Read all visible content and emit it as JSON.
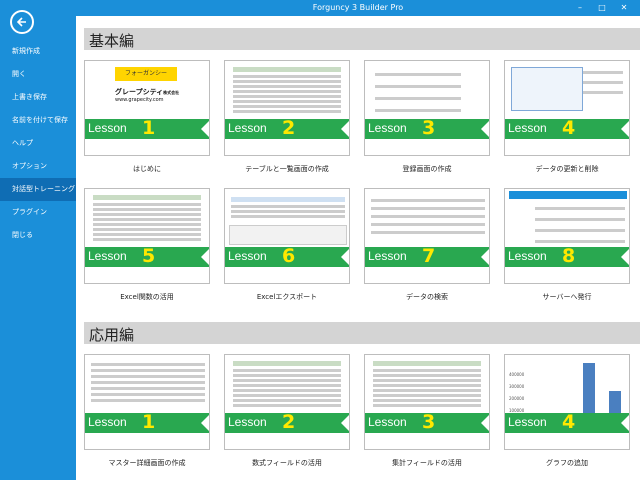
{
  "window": {
    "title": "Forguncy 3 Builder Pro",
    "min": "–",
    "max": "□",
    "close": "✕"
  },
  "sidebar": {
    "items": [
      {
        "label": "新規作成"
      },
      {
        "label": "開く"
      },
      {
        "label": "上書き保存"
      },
      {
        "label": "名前を付けて保存"
      },
      {
        "label": "ヘルプ"
      },
      {
        "label": "オプション"
      },
      {
        "label": "対話型トレーニング",
        "active": true
      },
      {
        "label": "プラグイン"
      },
      {
        "label": "閉じる"
      }
    ]
  },
  "sections": [
    {
      "title": "基本編",
      "cards": [
        {
          "lesson": "Lesson",
          "num": "1",
          "caption": "はじめに",
          "thumb": "logo"
        },
        {
          "lesson": "Lesson",
          "num": "2",
          "caption": "テーブルと一覧画面の作成",
          "thumb": "table"
        },
        {
          "lesson": "Lesson",
          "num": "3",
          "caption": "登録画面の作成",
          "thumb": "form"
        },
        {
          "lesson": "Lesson",
          "num": "4",
          "caption": "データの更新と削除",
          "thumb": "dialog"
        },
        {
          "lesson": "Lesson",
          "num": "5",
          "caption": "Excel関数の活用",
          "thumb": "table"
        },
        {
          "lesson": "Lesson",
          "num": "6",
          "caption": "Excelエクスポート",
          "thumb": "excel"
        },
        {
          "lesson": "Lesson",
          "num": "7",
          "caption": "データの検索",
          "thumb": "search"
        },
        {
          "lesson": "Lesson",
          "num": "8",
          "caption": "サーバーへ発行",
          "thumb": "publish"
        }
      ]
    },
    {
      "title": "応用編",
      "cards": [
        {
          "lesson": "Lesson",
          "num": "1",
          "caption": "マスター詳細画面の作成",
          "thumb": "master"
        },
        {
          "lesson": "Lesson",
          "num": "2",
          "caption": "数式フィールドの活用",
          "thumb": "table"
        },
        {
          "lesson": "Lesson",
          "num": "3",
          "caption": "集計フィールドの活用",
          "thumb": "table"
        },
        {
          "lesson": "Lesson",
          "num": "4",
          "caption": "グラフの追加",
          "thumb": "chart"
        }
      ]
    }
  ],
  "thumbs": {
    "logo_button": "フォーガンシー",
    "logo_company": "グレープシティ",
    "logo_company_suffix": "株式会社",
    "logo_url": "www.grapecity.com",
    "chart_ticks": [
      "400000",
      "300000",
      "200000",
      "100000"
    ]
  }
}
